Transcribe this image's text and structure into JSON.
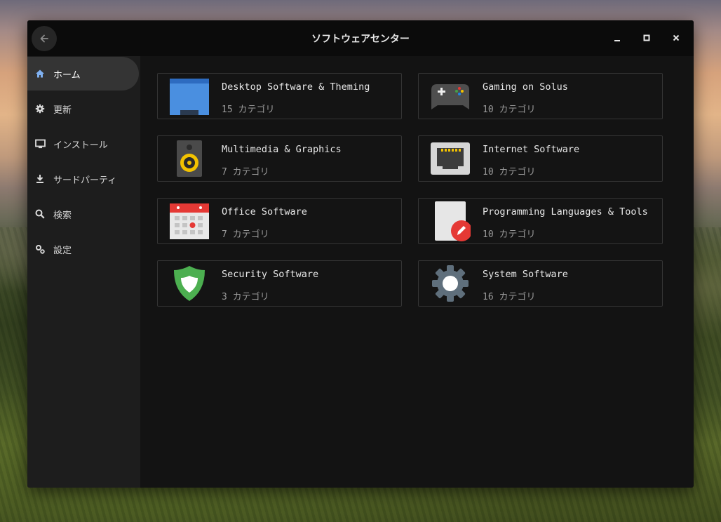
{
  "window": {
    "title": "ソフトウェアセンター",
    "controls": {
      "minimize": "minimize-icon",
      "maximize": "maximize-icon",
      "close": "close-icon"
    }
  },
  "sidebar": {
    "items": [
      {
        "label": "ホーム",
        "icon": "home-icon",
        "active": true
      },
      {
        "label": "更新",
        "icon": "gear-update-icon",
        "active": false
      },
      {
        "label": "インストール",
        "icon": "monitor-icon",
        "active": false
      },
      {
        "label": "サードパーティ",
        "icon": "download-icon",
        "active": false
      },
      {
        "label": "検索",
        "icon": "search-icon",
        "active": false
      },
      {
        "label": "設定",
        "icon": "settings-icon",
        "active": false
      }
    ]
  },
  "categories": [
    {
      "title": "Desktop Software & Theming",
      "subtitle": "15 カテゴリ",
      "icon": "desktop-folder-icon"
    },
    {
      "title": "Gaming on Solus",
      "subtitle": "10 カテゴリ",
      "icon": "gamepad-icon"
    },
    {
      "title": "Multimedia & Graphics",
      "subtitle": "7 カテゴリ",
      "icon": "speaker-icon"
    },
    {
      "title": "Internet Software",
      "subtitle": "10 カテゴリ",
      "icon": "network-port-icon"
    },
    {
      "title": "Office Software",
      "subtitle": "7 カテゴリ",
      "icon": "calendar-icon"
    },
    {
      "title": "Programming Languages & Tools",
      "subtitle": "10 カテゴリ",
      "icon": "document-edit-icon"
    },
    {
      "title": "Security Software",
      "subtitle": "3 カテゴリ",
      "icon": "shield-icon"
    },
    {
      "title": "System Software",
      "subtitle": "16 カテゴリ",
      "icon": "system-gear-icon"
    }
  ],
  "colors": {
    "window_bg": "#131313",
    "sidebar_bg": "#1d1d1d",
    "sidebar_active": "#343434",
    "card_border": "#343434",
    "accent_blue": "#4a8fe0",
    "accent_red": "#e53935",
    "accent_green": "#4caf50",
    "accent_yellow": "#f2c200"
  }
}
